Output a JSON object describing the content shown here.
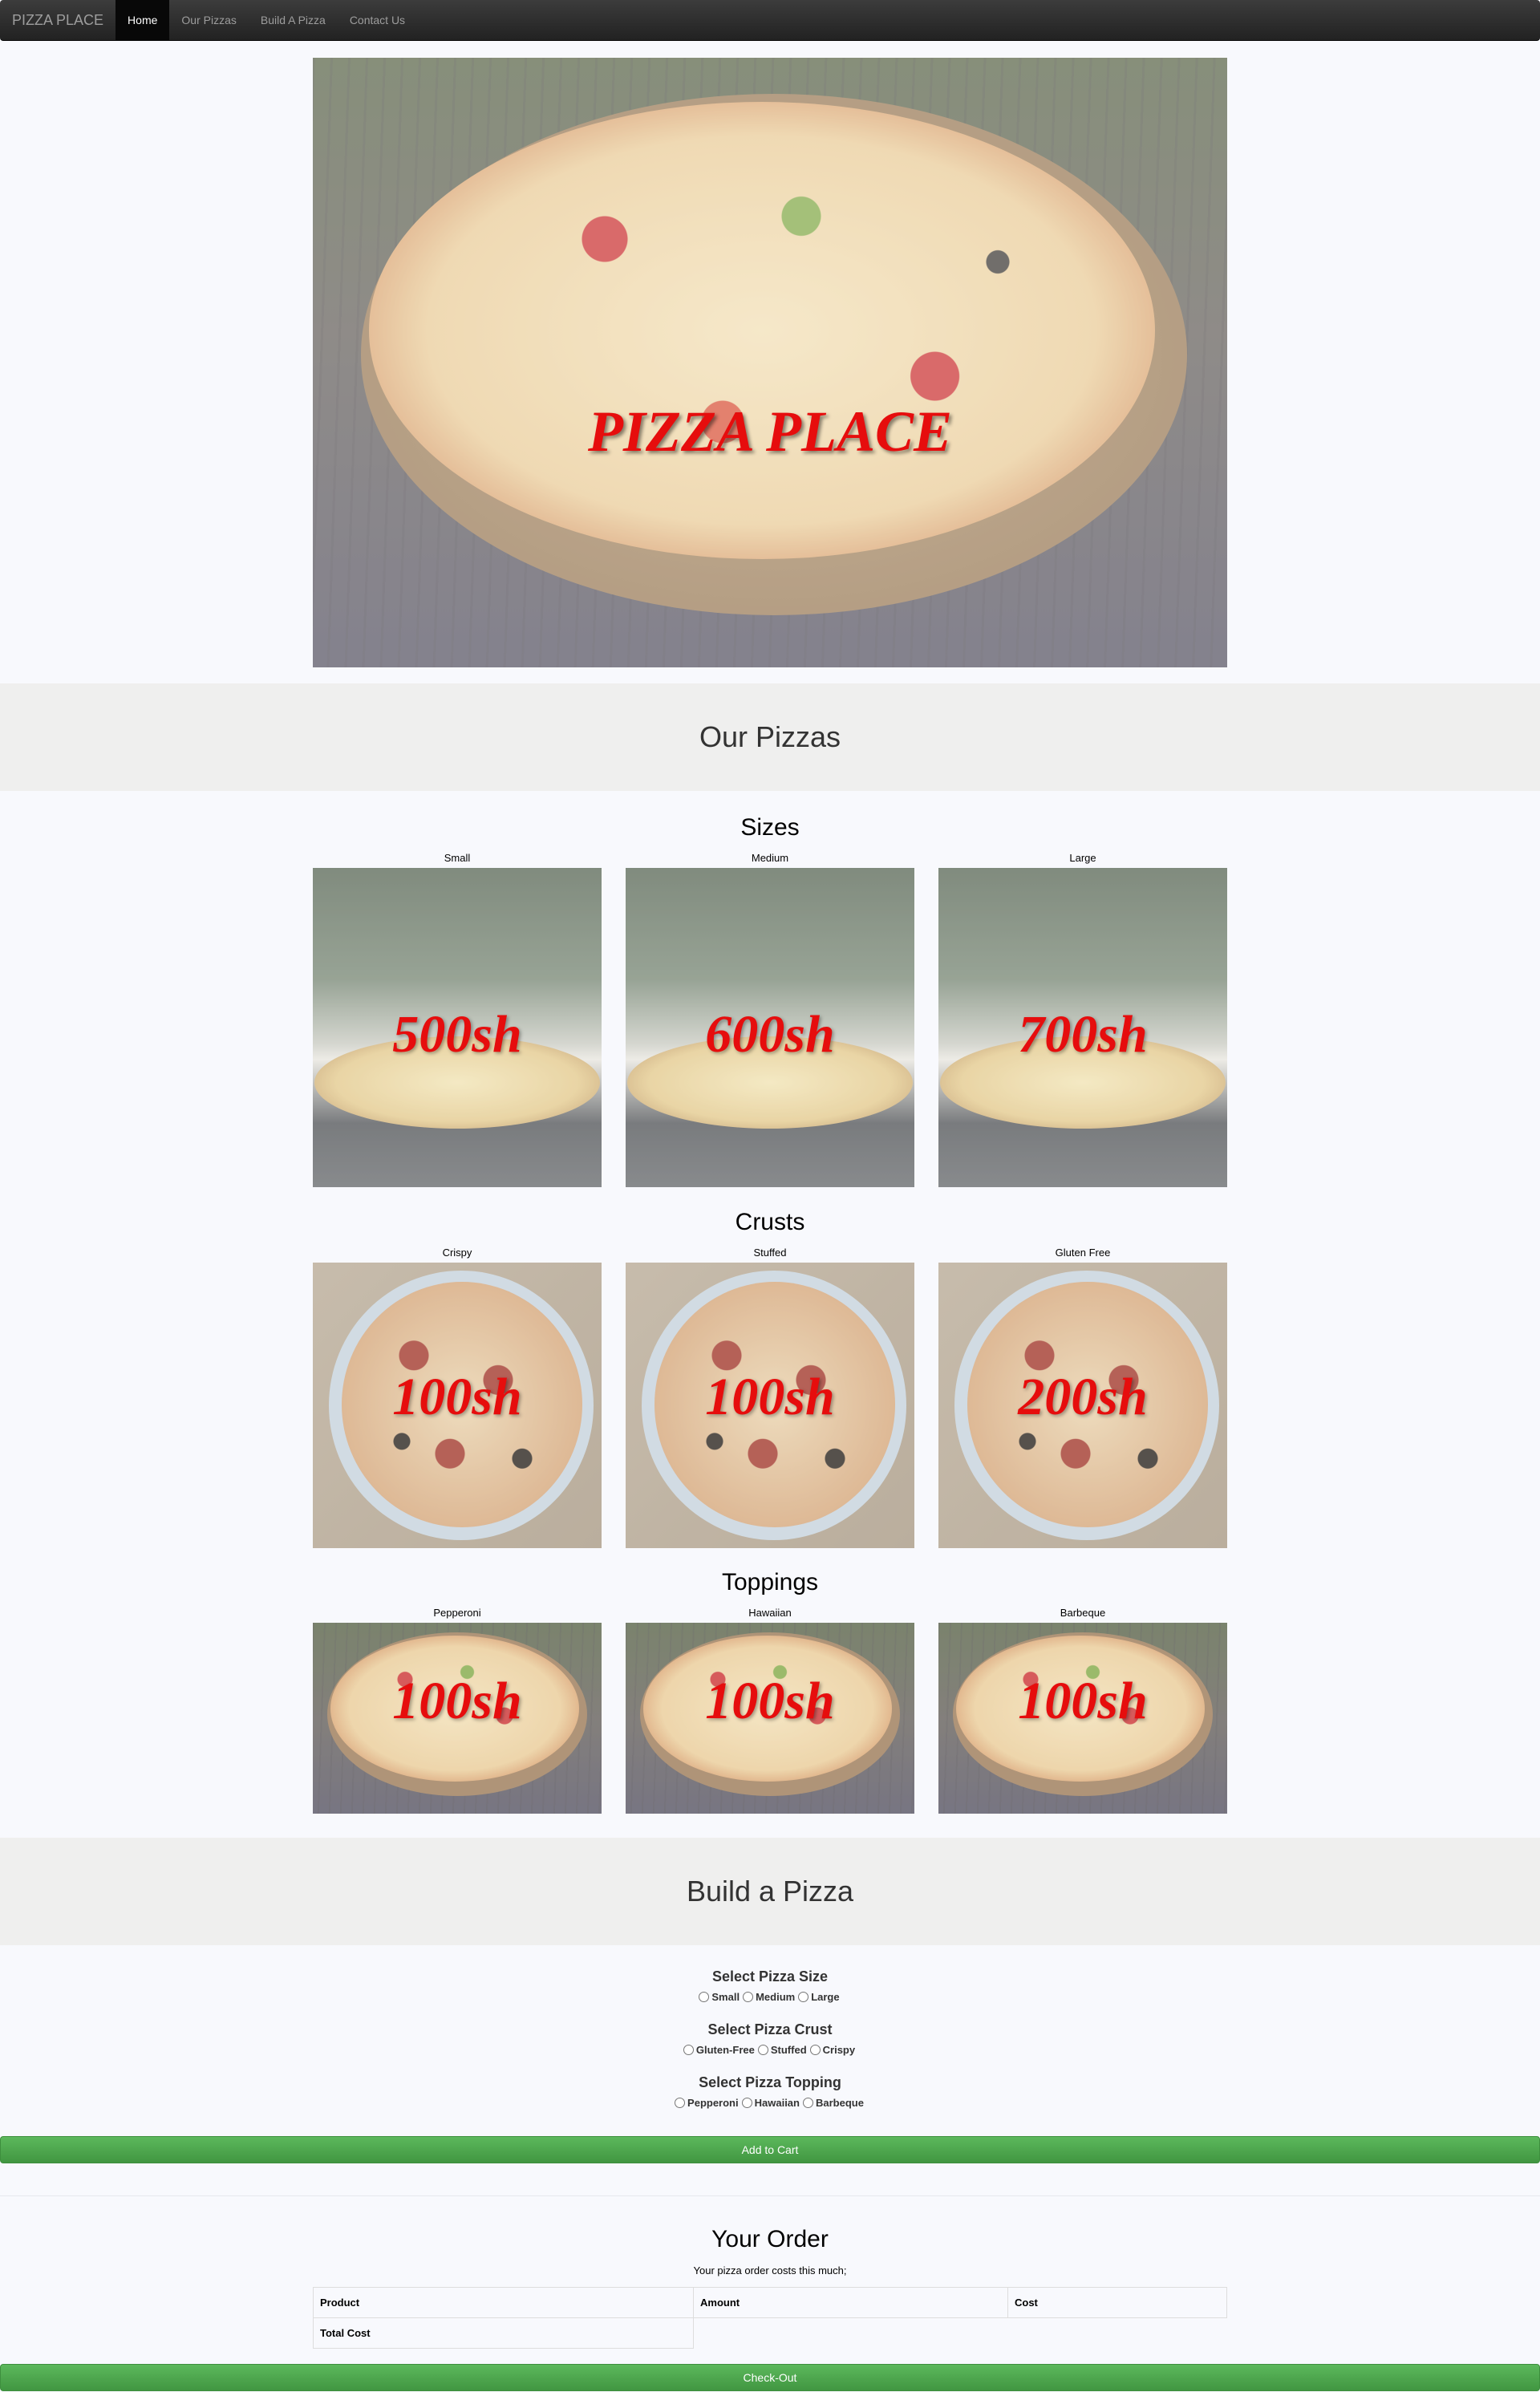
{
  "nav": {
    "brand": "PIZZA PLACE",
    "items": [
      {
        "label": "Home",
        "active": true
      },
      {
        "label": "Our Pizzas",
        "active": false
      },
      {
        "label": "Build A Pizza",
        "active": false
      },
      {
        "label": "Contact Us",
        "active": false
      }
    ]
  },
  "hero": {
    "title": "PIZZA PLACE"
  },
  "our_pizzas": {
    "heading": "Our Pizzas",
    "sizes": {
      "title": "Sizes",
      "items": [
        {
          "label": "Small",
          "price": "500sh"
        },
        {
          "label": "Medium",
          "price": "600sh"
        },
        {
          "label": "Large",
          "price": "700sh"
        }
      ]
    },
    "crusts": {
      "title": "Crusts",
      "items": [
        {
          "label": "Crispy",
          "price": "100sh"
        },
        {
          "label": "Stuffed",
          "price": "100sh"
        },
        {
          "label": "Gluten Free",
          "price": "200sh"
        }
      ]
    },
    "toppings": {
      "title": "Toppings",
      "items": [
        {
          "label": "Pepperoni",
          "price": "100sh"
        },
        {
          "label": "Hawaiian",
          "price": "100sh"
        },
        {
          "label": "Barbeque",
          "price": "100sh"
        }
      ]
    }
  },
  "build": {
    "heading": "Build a Pizza",
    "size": {
      "title": "Select Pizza Size",
      "options": [
        "Small",
        "Medium",
        "Large"
      ]
    },
    "crust": {
      "title": "Select Pizza Crust",
      "options": [
        "Gluten-Free",
        "Stuffed",
        "Crispy"
      ]
    },
    "topping": {
      "title": "Select Pizza Topping",
      "options": [
        "Pepperoni",
        "Hawaiian",
        "Barbeque"
      ]
    },
    "add_to_cart": "Add to Cart"
  },
  "order": {
    "title": "Your Order",
    "note": "Your pizza order costs this much;",
    "columns": [
      "Product",
      "Amount",
      "Cost"
    ],
    "total_label": "Total Cost",
    "checkout": "Check-Out"
  },
  "colors": {
    "price_red": "#e60d0d",
    "button_green": "#5cb85c",
    "navbar": "#222222"
  }
}
